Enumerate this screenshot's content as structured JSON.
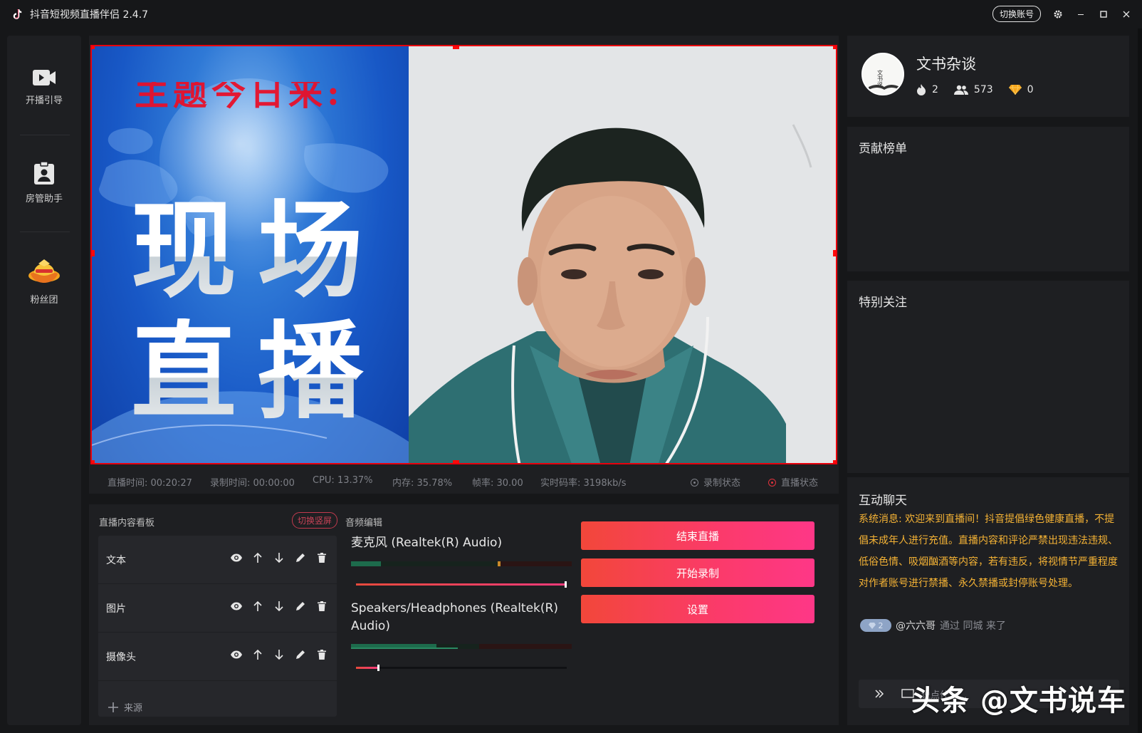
{
  "app": {
    "title": "抖音短视频直播伴侣 2.4.7",
    "switch_account": "切换账号"
  },
  "nav": {
    "items": [
      {
        "label": "开播引导",
        "icon": "video-camera-icon"
      },
      {
        "label": "房管助手",
        "icon": "badge-icon"
      },
      {
        "label": "粉丝团",
        "icon": "fan-club-icon"
      }
    ]
  },
  "preview": {
    "poster_top_text": "主题今日来:",
    "poster_big_line1": "现场",
    "poster_big_line2": "直播"
  },
  "stats": {
    "live_time": "直播时间: 00:20:27",
    "record_time": "录制时间: 00:00:00",
    "cpu": "CPU: 13.37%",
    "memory": "内存: 35.78%",
    "fps": "帧率: 30.00",
    "bitrate": "实时码率: 3198kb/s",
    "record_status": "录制状态",
    "live_status": "直播状态"
  },
  "board": {
    "title": "直播内容看板",
    "switch_vertical": "切换竖屏",
    "sources": [
      "文本",
      "图片",
      "摄像头"
    ],
    "add_source": "来源"
  },
  "audio": {
    "title": "音频编辑",
    "mic_name": "麦克风 (Realtek(R) Audio)",
    "mic_volume": 1.0,
    "speaker_name": "Speakers/Headphones (Realtek(R) Audio)",
    "speaker_volume": 0.1
  },
  "actions": {
    "end_live": "结束直播",
    "start_record": "开始录制",
    "settings": "设置"
  },
  "profile": {
    "name": "文书杂谈",
    "avatar_text": "文书说",
    "likes": "2",
    "fans": "573",
    "diamonds": "0"
  },
  "panels": {
    "contribution": "贡献榜单",
    "special_follow": "特别关注",
    "chat_title": "互动聊天"
  },
  "chat": {
    "system_message": "系统消息: 欢迎来到直播间！抖音提倡绿色健康直播，不提倡未成年人进行充值。直播内容和评论严禁出现违法违规、低俗色情、吸烟酗酒等内容，若有违反，将视情节严重程度对作者账号进行禁播、永久禁播或封停账号处理。",
    "badge_level": "2",
    "user": "@六六哥",
    "action": "通过 同城 来了",
    "input_placeholder": "说点什么..."
  },
  "watermark": "头条 @文书说车",
  "colors": {
    "accent_gradient_start": "#f2473a",
    "accent_gradient_end": "#fe3787",
    "system_message": "#f5b335",
    "selection_border": "#e8000c"
  }
}
